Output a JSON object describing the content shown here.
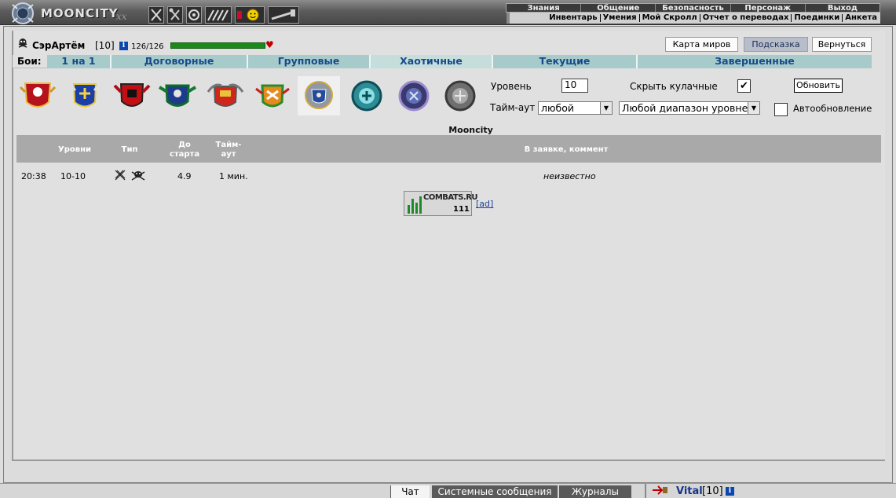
{
  "app": {
    "logo": "MOONCITY",
    "logo_suffix": "xx"
  },
  "nav": {
    "main": [
      "Знания",
      "Общение",
      "Безопасность",
      "Персонаж",
      "Выход"
    ],
    "sub": [
      "Инвентарь",
      "Умения",
      "Мой Скролл",
      "Отчет о переводах",
      "Поединки",
      "Анкета"
    ]
  },
  "character": {
    "name": "СэрАртём",
    "level": "[10]",
    "hp": "126/126",
    "hp_fraction": 1.0
  },
  "header_buttons": {
    "map": "Карта миров",
    "hint": "Подсказка",
    "back": "Вернуться"
  },
  "tabs": {
    "label": "Бои:",
    "items": [
      "1 на 1",
      "Договорные",
      "Групповые",
      "Хаотичные",
      "Текущие",
      "Завершенные"
    ],
    "active": "Хаотичные"
  },
  "emblems": {
    "selected_index": 6,
    "items": [
      "emblem-1-icon",
      "emblem-2-icon",
      "emblem-3-icon",
      "emblem-4-icon",
      "emblem-5-icon",
      "emblem-6-icon",
      "emblem-7-icon",
      "emblem-8-icon",
      "emblem-9-icon",
      "emblem-10-icon"
    ]
  },
  "filters": {
    "level_label": "Уровень",
    "level_value": "10",
    "hide_fists_label": "Скрыть кулачные",
    "hide_fists_checked": true,
    "refresh_label": "Обновить",
    "timeout_label": "Тайм-аут",
    "timeout_value": "любой",
    "range_value": "Любой диапазон уровней",
    "autorefresh_label": "Автообновление",
    "autorefresh_checked": false
  },
  "table": {
    "title": "Mooncity",
    "headers": {
      "levels": "Уровни",
      "type": "Тип",
      "start_1": "До",
      "start_2": "старта",
      "timeout_1": "Тайм-",
      "timeout_2": "аут",
      "comment": "В заявке, коммент"
    },
    "rows": [
      {
        "time": "20:38",
        "levels": "10-10",
        "type_icons": [
          "crossed-swords-icon",
          "battle-group-icon"
        ],
        "start": "4.9",
        "timeout": "1 мин.",
        "comment": "неизвестно"
      }
    ]
  },
  "combats_badge": {
    "text": "COMBATS.RU",
    "count": "111",
    "ad": "[ad]"
  },
  "bottom_tabs": {
    "chat": "Чат",
    "system": "Системные сообщения",
    "logs": "Журналы"
  },
  "partner": {
    "name": "Vital",
    "level": "[10]"
  },
  "colors": {
    "tab_bg": "#a7cbcb",
    "tab_text": "#174a8a",
    "hp_green": "#1b8a1b",
    "table_header": "#a9a9a9"
  }
}
